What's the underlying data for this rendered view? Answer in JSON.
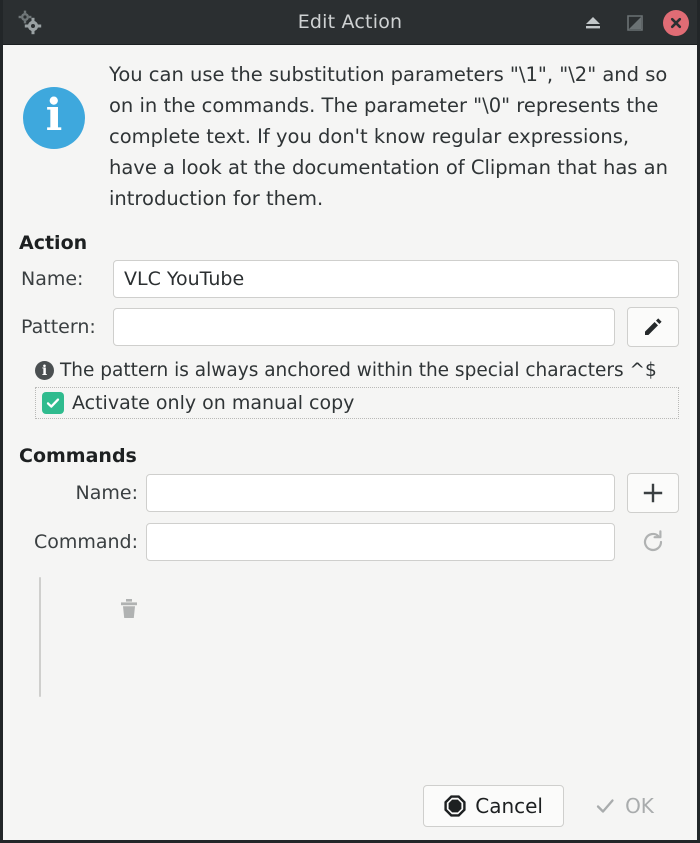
{
  "window": {
    "title": "Edit Action",
    "app_icon": "gears-icon",
    "controls": {
      "shade_label": "shade",
      "restore_label": "restore",
      "close_label": "close"
    }
  },
  "info": {
    "icon": "info-circle-icon",
    "text": "You can use the substitution parameters \"\\1\", \"\\2\" and so on in the commands. The parameter \"\\0\" represents the complete text. If you don't know regular expressions, have a look at the documentation of Clipman that has an introduction for them."
  },
  "action": {
    "heading": "Action",
    "name_label": "Name:",
    "name_value": "VLC YouTube",
    "name_placeholder": "",
    "pattern_label": "Pattern:",
    "pattern_value": "",
    "pattern_placeholder": "",
    "edit_button_icon": "pencil-icon",
    "hint_icon": "info-small-icon",
    "hint_text": "The pattern is always anchored within the special characters ^$",
    "checkbox_label": "Activate only on manual copy",
    "checkbox_checked": true
  },
  "commands": {
    "heading": "Commands",
    "name_label": "Name:",
    "name_value": "",
    "name_placeholder": "",
    "add_button_icon": "plus-icon",
    "command_label": "Command:",
    "command_value": "",
    "command_placeholder": "",
    "refresh_button_icon": "refresh-icon",
    "delete_button_icon": "trash-icon",
    "list_items": []
  },
  "footer": {
    "cancel_label": "Cancel",
    "cancel_icon": "stop-octagon-icon",
    "ok_label": "OK",
    "ok_icon": "check-icon",
    "ok_enabled": false
  },
  "colors": {
    "titlebar": "#2b2f31",
    "dialog_bg": "#f5f5f4",
    "info_blue": "#3ea8dd",
    "check_green": "#2fbb8e",
    "close_red": "#e06c75"
  }
}
